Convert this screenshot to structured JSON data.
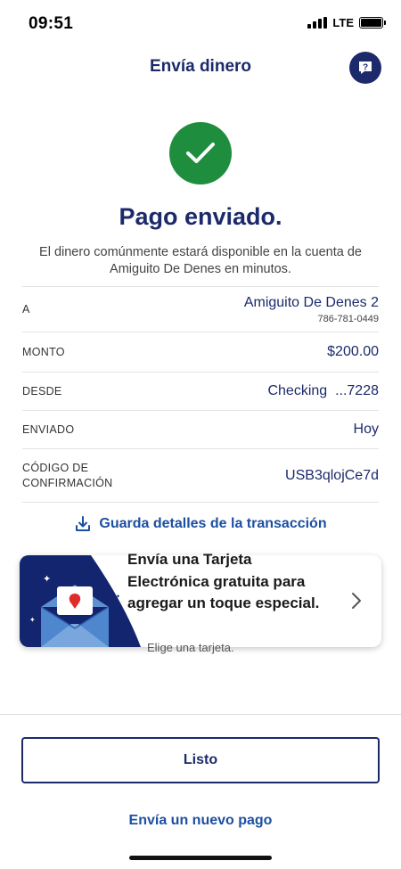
{
  "status_bar": {
    "time": "09:51",
    "network": "LTE"
  },
  "header": {
    "title": "Envía dinero",
    "help_icon": "question-bubble-icon"
  },
  "success": {
    "icon": "checkmark-icon",
    "title": "Pago enviado.",
    "message": "El dinero comúnmente estará disponible en la cuenta de Amiguito De Denes en minutos."
  },
  "details": {
    "recipient": {
      "label": "A",
      "name": "Amiguito De Denes 2",
      "phone": "786-781-0449"
    },
    "amount": {
      "label": "MONTO",
      "value": "$200.00"
    },
    "from": {
      "label": "DESDE",
      "value": "Checking  ...7228"
    },
    "sent": {
      "label": "ENVIADO",
      "value": "Hoy"
    },
    "confirmation": {
      "label": "CÓDIGO DE CONFIRMACIÓN",
      "value": "USB3qlojCe7d"
    }
  },
  "save_details": {
    "icon": "download-icon",
    "label": "Guarda detalles de la transacción"
  },
  "promo": {
    "title": "Envía una Tarjeta Electrónica gratuita para agregar un toque especial.",
    "subtitle": "Elige una tarjeta.",
    "art_icon": "envelope-card-icon",
    "chevron_icon": "chevron-right-icon"
  },
  "actions": {
    "done_label": "Listo",
    "new_payment_label": "Envía un nuevo pago"
  },
  "colors": {
    "primary_navy": "#1c2a6b",
    "link_blue": "#1c4fa1",
    "success_green": "#1e8e3e"
  }
}
